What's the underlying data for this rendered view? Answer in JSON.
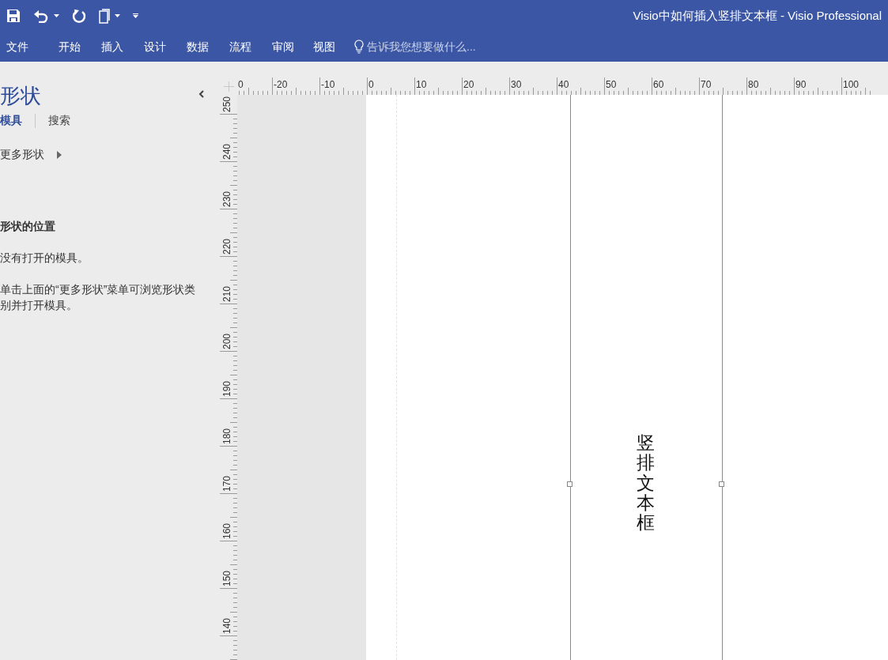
{
  "window": {
    "title": "Visio中如何插入竖排文本框 - Visio Professional"
  },
  "ribbon_tabs": [
    {
      "label": "文件"
    },
    {
      "label": "开始"
    },
    {
      "label": "插入"
    },
    {
      "label": "设计"
    },
    {
      "label": "数据"
    },
    {
      "label": "流程"
    },
    {
      "label": "审阅"
    },
    {
      "label": "视图"
    }
  ],
  "tell_me": {
    "placeholder": "告诉我您想要做什么..."
  },
  "shapes_pane": {
    "title": "形状",
    "tabs": [
      {
        "label": "模具",
        "selected": true
      },
      {
        "label": "搜索",
        "selected": false
      }
    ],
    "more_shapes": "更多形状",
    "section_heading": "形状的位置",
    "messages": [
      "没有打开的模具。",
      "单击上面的“更多形状”菜单可浏览形状类别并打开模具。"
    ]
  },
  "rulers": {
    "top_labels": [
      "0",
      "-20",
      "-10",
      "0",
      "10",
      "20",
      "30",
      "40",
      "50",
      "60",
      "70",
      "80",
      "90",
      "100"
    ],
    "left_labels": [
      "250",
      "240",
      "230",
      "220",
      "210",
      "200",
      "190",
      "180",
      "170",
      "160",
      "150",
      "140"
    ]
  },
  "canvas": {
    "text_box": {
      "text": "竖排文本框",
      "selected": true
    }
  }
}
